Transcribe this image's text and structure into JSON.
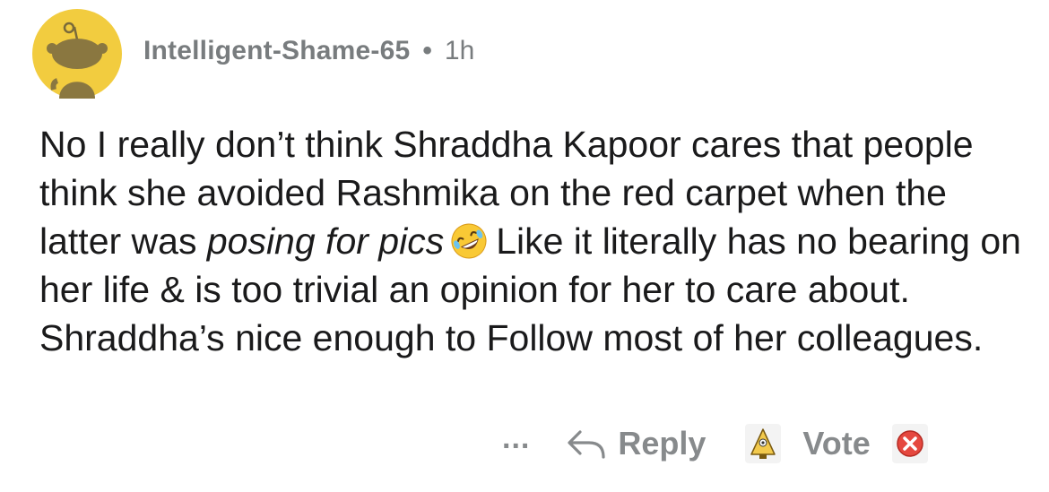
{
  "comment": {
    "username": "Intelligent-Shame-65",
    "separator": "•",
    "time": "1h",
    "body": {
      "text_1": "No I really don’t think Shraddha Kapoor cares that people think she avoided Rashmika on the red carpet when the latter was ",
      "italic": "posing for pics",
      "text_2": "Like it literally has no bearing on her life & is too trivial an opinion for her to care about. Shraddha’s nice enough to Follow most of her colleagues."
    }
  },
  "actions": {
    "more_label": "...",
    "reply_label": "Reply",
    "vote_label": "Vote"
  },
  "icons": {
    "avatar": "reddit-snoo-avatar",
    "emoji": "rolling-on-floor-laughing-emoji",
    "reply": "reply-arrow-icon",
    "upvote": "award-upvote-icon",
    "downvote": "downvote-x-icon"
  },
  "colors": {
    "avatar_bg": "#f2cc3f",
    "meta_gray": "#787c7e",
    "text": "#1a1a1b",
    "action_gray": "#878a8c"
  }
}
